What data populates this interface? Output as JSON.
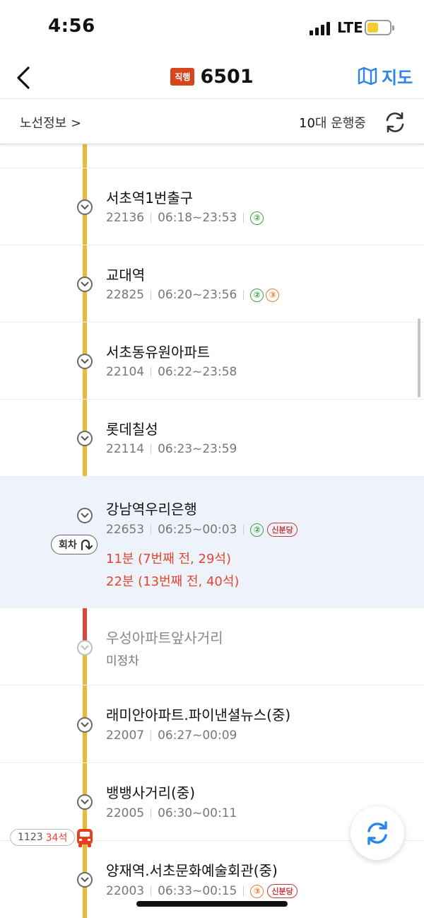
{
  "status_bar": {
    "time": "4:56",
    "network": "LTE",
    "battery_level": 0.4
  },
  "nav": {
    "title_badge": "직행",
    "title": "6501",
    "map_label": "지도",
    "accent_color": "#2b86ea"
  },
  "subheader": {
    "route_info": "노선정보 >",
    "running_count": "10",
    "running_suffix": "대 운행중"
  },
  "stops": [
    {
      "name": "서초역1번출구",
      "code": "22136",
      "hours": "06:18~23:53",
      "badges": [
        "②"
      ]
    },
    {
      "name": "교대역",
      "code": "22825",
      "hours": "06:20~23:56",
      "badges": [
        "②",
        "③"
      ]
    },
    {
      "name": "서초동유원아파트",
      "code": "22104",
      "hours": "06:22~23:58",
      "badges": []
    },
    {
      "name": "롯데칠성",
      "code": "22114",
      "hours": "06:23~23:59",
      "badges": []
    },
    {
      "name": "강남역우리은행",
      "code": "22653",
      "hours": "06:25~00:03",
      "badges": [
        "②"
      ],
      "extra_badge": "신분당",
      "arrivals": [
        "11분 (7번째 전, 29석)",
        "22분 (13번째 전, 40석)"
      ]
    },
    {
      "name": "우성아파트앞사거리",
      "status": "미정차"
    },
    {
      "name": "래미안아파트.파이낸셜뉴스(중)",
      "code": "22007",
      "hours": "06:27~00:09",
      "badges": []
    },
    {
      "name": "뱅뱅사거리(중)",
      "code": "22005",
      "hours": "06:30~00:11",
      "badges": []
    },
    {
      "name": "양재역.서초문화예술회관(중)",
      "code": "22003",
      "hours": "06:33~00:15",
      "badges": [
        "③"
      ],
      "extra_badge": "신분당"
    }
  ],
  "turn_badge": "회차",
  "bus_marker": {
    "plate": "1123",
    "seats": "34석"
  },
  "colors": {
    "line_yellow": "#e8b93a",
    "line_red": "#d9463d",
    "arrival_red": "#e3452e",
    "highlight_bg": "#eef3fb"
  }
}
